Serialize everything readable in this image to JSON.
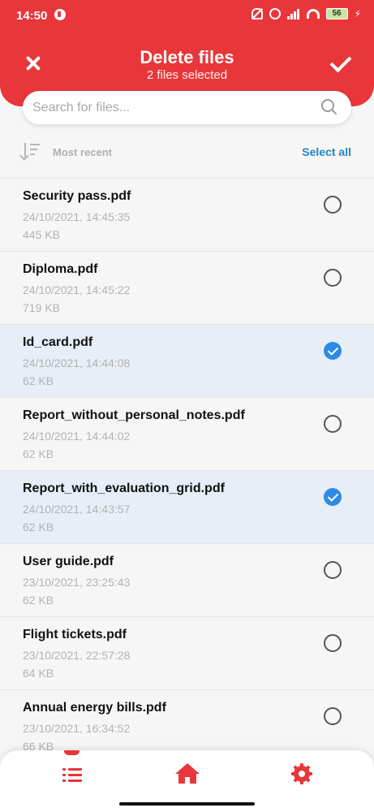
{
  "status_bar": {
    "time": "14:50",
    "battery": "56",
    "icons": [
      "app-icon",
      "bell-off-icon",
      "alarm-icon",
      "signal-icon",
      "wifi-icon",
      "battery-icon",
      "charging-icon"
    ]
  },
  "header": {
    "title": "Delete files",
    "subtitle": "2 files selected",
    "close_icon": "close-icon",
    "confirm_icon": "check-icon",
    "accent_color": "#e8363a"
  },
  "search": {
    "placeholder": "Search for files...",
    "value": "",
    "icon": "search-icon"
  },
  "sort": {
    "label": "Most recent",
    "icon": "sort-descending-icon",
    "select_all_label": "Select all",
    "select_all_color": "#1f86c8"
  },
  "files": [
    {
      "name": "Security pass.pdf",
      "date": "24/10/2021, 14:45:35",
      "size": "445 KB",
      "selected": false
    },
    {
      "name": "Diploma.pdf",
      "date": "24/10/2021, 14:45:22",
      "size": "719 KB",
      "selected": false
    },
    {
      "name": "Id_card.pdf",
      "date": "24/10/2021, 14:44:08",
      "size": "62 KB",
      "selected": true
    },
    {
      "name": "Report_without_personal_notes.pdf",
      "date": "24/10/2021, 14:44:02",
      "size": "62 KB",
      "selected": false
    },
    {
      "name": "Report_with_evaluation_grid.pdf",
      "date": "24/10/2021, 14:43:57",
      "size": "62 KB",
      "selected": true
    },
    {
      "name": "User guide.pdf",
      "date": "23/10/2021, 23:25:43",
      "size": "62 KB",
      "selected": false
    },
    {
      "name": "Flight tickets.pdf",
      "date": "23/10/2021, 22:57:28",
      "size": "64 KB",
      "selected": false
    },
    {
      "name": "Annual energy bills.pdf",
      "date": "23/10/2021, 16:34:52",
      "size": "66 KB",
      "selected": false
    }
  ],
  "bottom_nav": {
    "items": [
      {
        "icon": "list-icon",
        "active": true
      },
      {
        "icon": "home-icon",
        "active": false
      },
      {
        "icon": "settings-icon",
        "active": false
      }
    ]
  }
}
